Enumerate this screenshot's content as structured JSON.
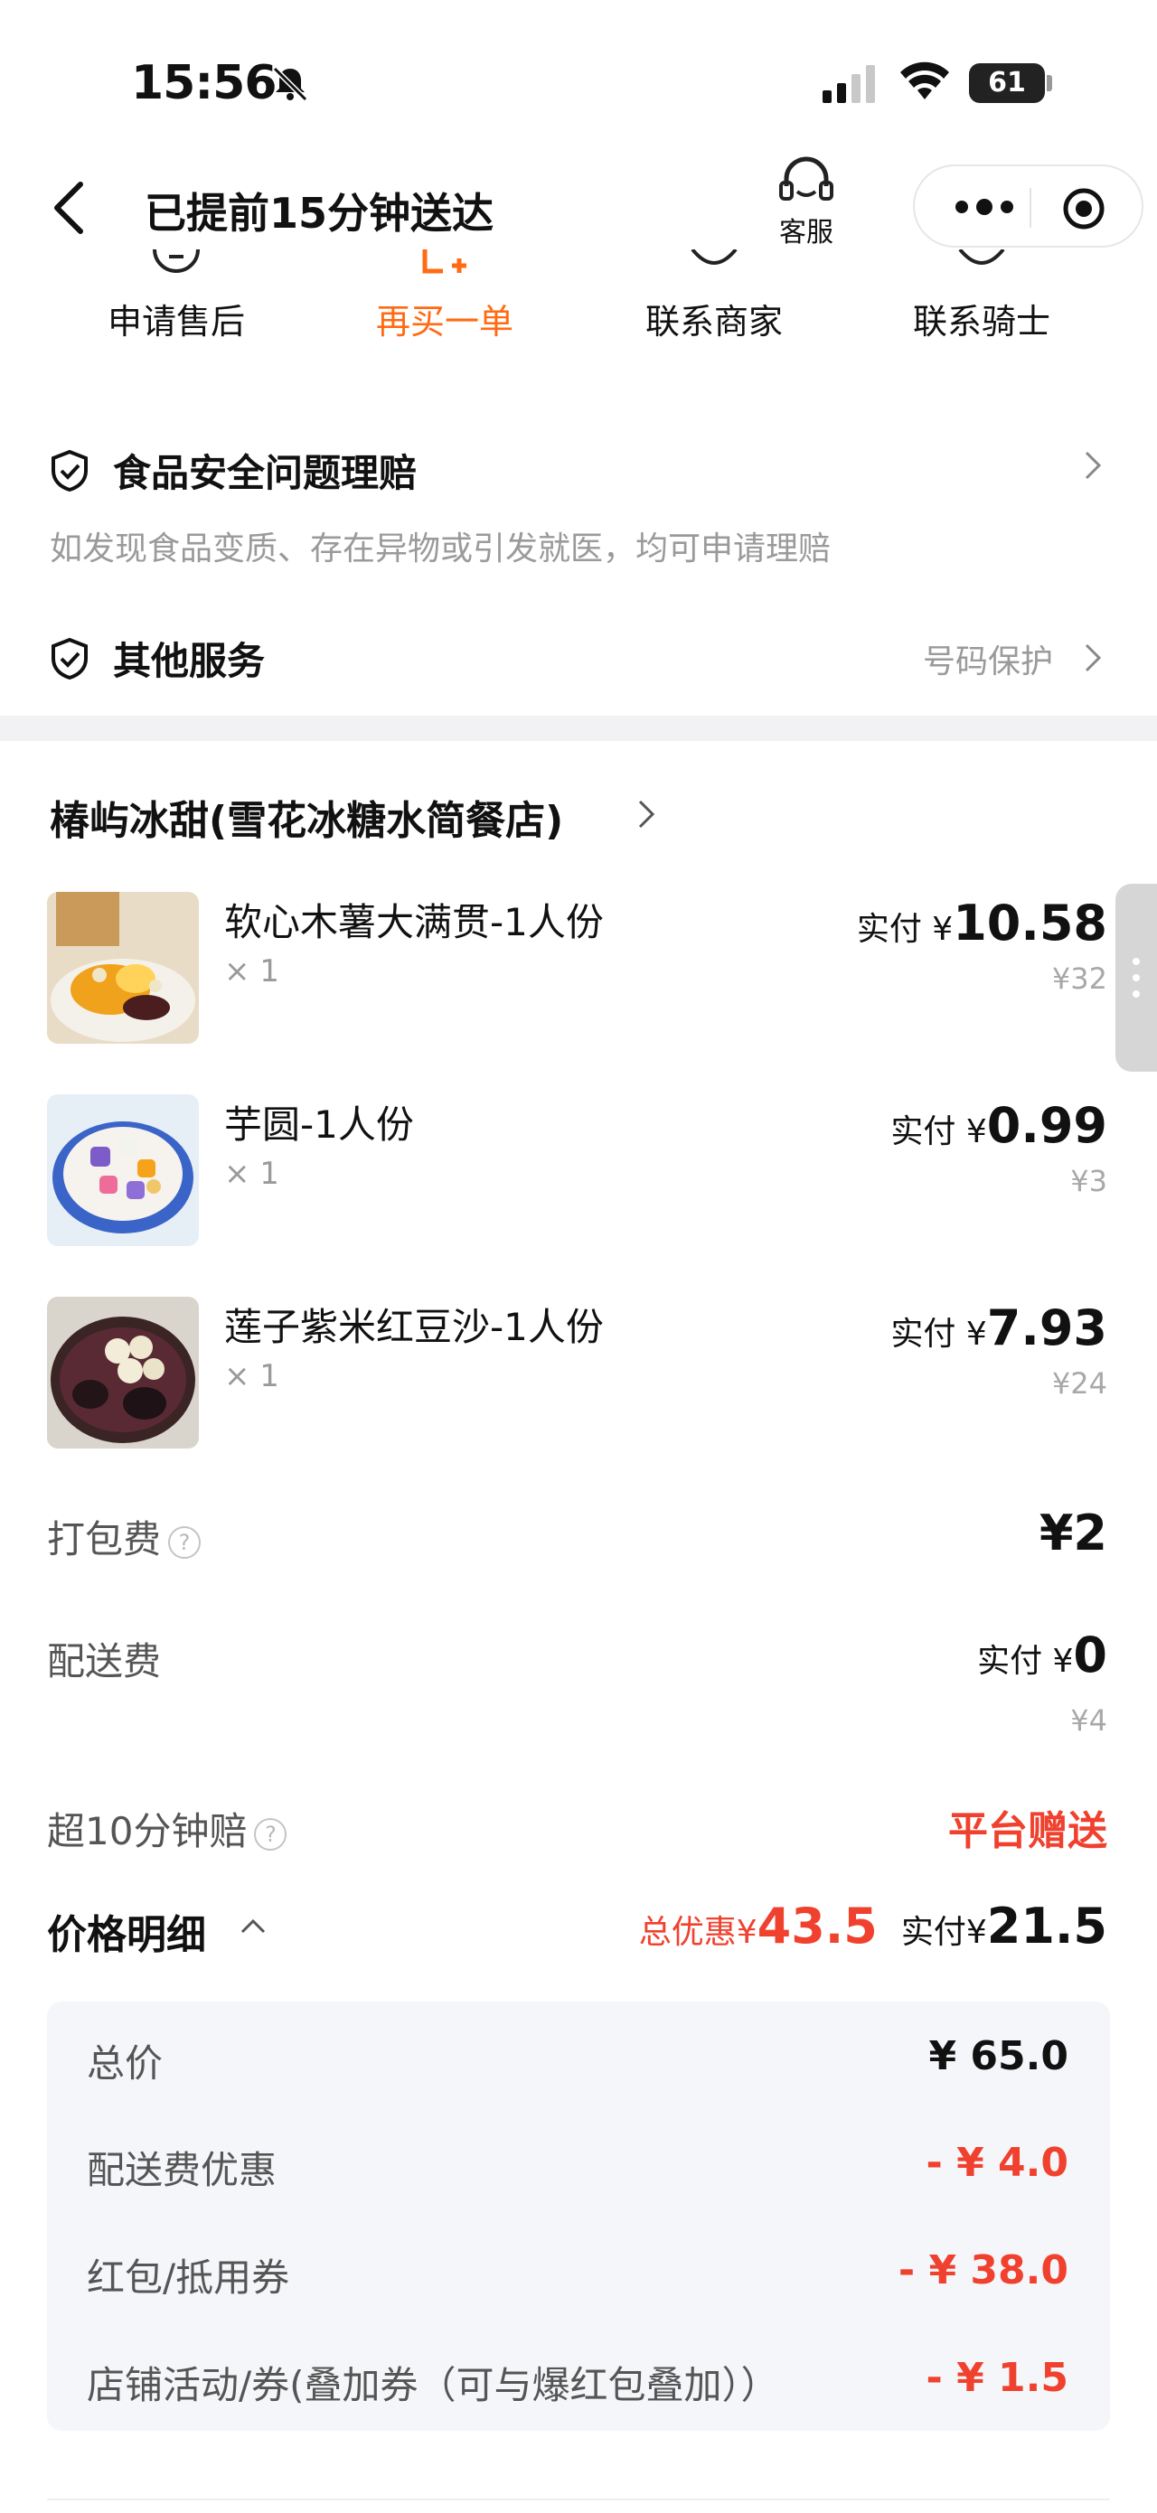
{
  "status_bar": {
    "time": "15:56",
    "battery": "61"
  },
  "nav": {
    "title": "已提前15分钟送达",
    "customer_service": "客服"
  },
  "actions": [
    {
      "label": "申请售后"
    },
    {
      "label": "再买一单"
    },
    {
      "label": "联系商家"
    },
    {
      "label": "联系骑士"
    }
  ],
  "services": {
    "food_safety": {
      "title": "食品安全问题理赔",
      "desc": "如发现食品变质、存在异物或引发就医，均可申请理赔"
    },
    "other": {
      "title": "其他服务",
      "right": "号码保护"
    }
  },
  "store": {
    "name": "椿屿冰甜(雪花冰糖水简餐店)",
    "items": [
      {
        "name": "软心木薯大满贯-1人份",
        "qty": "× 1",
        "paid_label": "实付 ¥",
        "paid": "10.58",
        "original": "¥32"
      },
      {
        "name": "芋圆-1人份",
        "qty": "× 1",
        "paid_label": "实付 ¥",
        "paid": "0.99",
        "original": "¥3"
      },
      {
        "name": "莲子紫米红豆沙-1人份",
        "qty": "× 1",
        "paid_label": "实付 ¥",
        "paid": "7.93",
        "original": "¥24"
      }
    ]
  },
  "fees": {
    "packing": {
      "label": "打包费",
      "value": "¥2"
    },
    "delivery": {
      "label": "配送费",
      "paid_label": "实付 ¥",
      "value": "0",
      "original": "¥4"
    },
    "late_comp": {
      "label": "超10分钟赔",
      "value": "平台赠送"
    }
  },
  "price_detail": {
    "title": "价格明细",
    "total_discount_label": "总优惠¥",
    "total_discount": "43.5",
    "paid_label": "实付¥",
    "paid": "21.5",
    "rows": [
      {
        "label": "总价",
        "value": "¥ 65.0"
      },
      {
        "label": "配送费优惠",
        "value": "- ¥ 4.0"
      },
      {
        "label": "红包/抵用券",
        "value": "- ¥ 38.0"
      },
      {
        "label": "店铺活动/券(叠加券（可与爆红包叠加））",
        "value": "- ¥ 1.5"
      }
    ]
  },
  "colors": {
    "accent": "#ff6a13",
    "discount_red": "#f0412f",
    "muted": "#9a9a9a"
  }
}
